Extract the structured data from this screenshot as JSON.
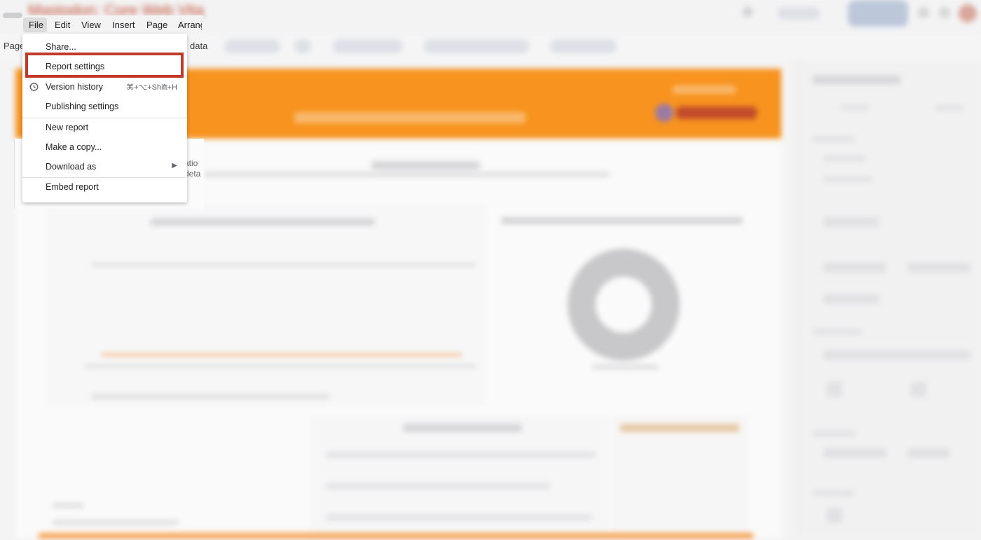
{
  "app": {
    "title": "Mastodon: Core Web Vita"
  },
  "menubar": {
    "items": [
      "File",
      "Edit",
      "View",
      "Insert",
      "Page",
      "Arrang"
    ]
  },
  "toolbar": {
    "page_label": "Page",
    "data_fragment": "data"
  },
  "file_menu": {
    "items": [
      {
        "label": "Share...",
        "shortcut": ""
      },
      {
        "label": "Report settings",
        "shortcut": "",
        "highlighted": true
      },
      {
        "label": "Version history",
        "shortcut": "⌘+⌥+Shift+H",
        "icon": "history-icon"
      },
      {
        "label": "Publishing settings",
        "shortcut": ""
      },
      {
        "label": "New report",
        "shortcut": ""
      },
      {
        "label": "Make a copy...",
        "shortcut": ""
      },
      {
        "label": "Download as",
        "shortcut": "",
        "submenu": true
      },
      {
        "label": "Embed report",
        "shortcut": ""
      }
    ]
  },
  "background_fragments": {
    "line1": "atio",
    "line2": "deta"
  },
  "colors": {
    "banner": "#f7931e",
    "highlight_box": "#c0392b",
    "title": "#c04a2f"
  }
}
